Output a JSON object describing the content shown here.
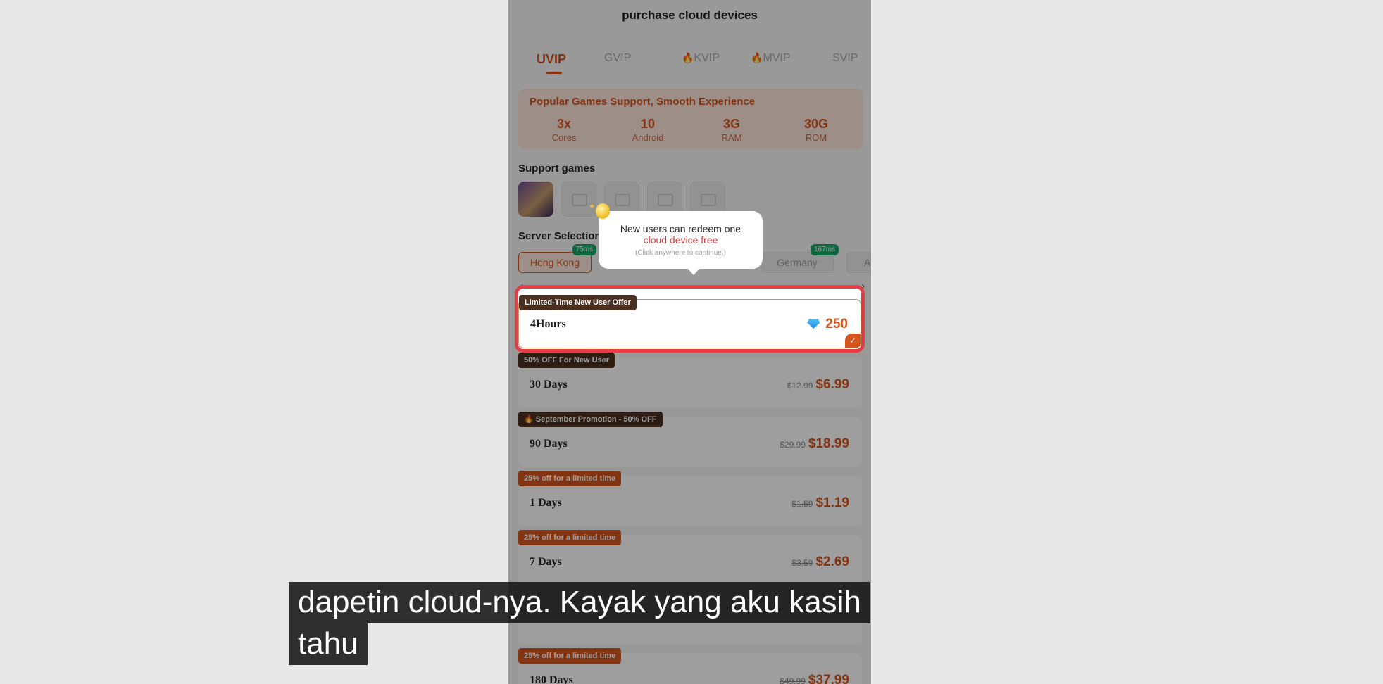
{
  "title": "purchase cloud devices",
  "tabs": [
    "UVIP",
    "GVIP",
    "KVIP",
    "MVIP",
    "SVIP"
  ],
  "specs": {
    "heading": "Popular Games Support, Smooth Experience",
    "items": [
      {
        "value": "3x",
        "label": "Cores"
      },
      {
        "value": "10",
        "label": "Android"
      },
      {
        "value": "3G",
        "label": "RAM"
      },
      {
        "value": "30G",
        "label": "ROM"
      }
    ]
  },
  "support_games": {
    "heading": "Support games"
  },
  "server": {
    "heading": "Server Selection",
    "items": [
      {
        "name": "Hong Kong",
        "ping": "75ms"
      },
      {
        "name": "Germany",
        "ping": "167ms"
      },
      {
        "name": "A"
      }
    ]
  },
  "tooltip": {
    "line1": "New users can redeem one",
    "line2": "cloud device free",
    "line3": "(Click anywhere to continue.)"
  },
  "plans": [
    {
      "badge": "Limited-Time New User Offer",
      "name": "4Hours",
      "price": "250"
    },
    {
      "badge": "50% OFF For New User",
      "name": "30 Days",
      "old": "$12.99",
      "new": "$6.99"
    },
    {
      "badge": "🔥 September Promotion - 50% OFF",
      "name": "90 Days",
      "old": "$29.99",
      "new": "$18.99"
    },
    {
      "badge": "25% off for a limited time",
      "name": "1 Days",
      "old": "$1.59",
      "new": "$1.19"
    },
    {
      "badge": "25% off for a limited time",
      "name": "7 Days",
      "old": "$3.59",
      "new": "$2.69"
    },
    {
      "badge": "25% off for a limited time",
      "name": "180 Days",
      "old": "$49.99",
      "new": "$37.99"
    }
  ],
  "subtitle": {
    "line1": "dapetin cloud-nya. Kayak yang aku kasih",
    "line2": "tahu"
  },
  "colors": {
    "accent": "#d4551d",
    "highlight": "#e23e45",
    "ping": "#14a86a"
  }
}
